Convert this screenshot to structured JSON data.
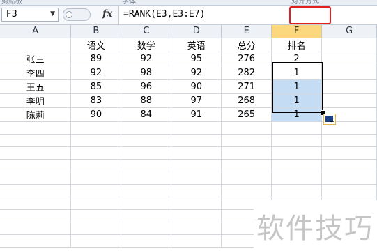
{
  "ribbon": {
    "left_label": "剪贴板",
    "mid_label": "字体",
    "right_label": "对齐方式"
  },
  "formula_bar": {
    "name_box": "F3",
    "fx_label": "fx",
    "formula": "=RANK(E3,E3:E7)"
  },
  "columns": [
    "A",
    "B",
    "C",
    "D",
    "E",
    "F",
    "G"
  ],
  "headers": [
    "",
    "语文",
    "数学",
    "英语",
    "总分",
    "排名",
    ""
  ],
  "rows": [
    {
      "name": "张三",
      "chinese": "89",
      "math": "92",
      "english": "95",
      "total": "276",
      "rank": "2"
    },
    {
      "name": "李四",
      "chinese": "92",
      "math": "98",
      "english": "92",
      "total": "282",
      "rank": "1"
    },
    {
      "name": "王五",
      "chinese": "85",
      "math": "96",
      "english": "90",
      "total": "271",
      "rank": "1"
    },
    {
      "name": "李明",
      "chinese": "83",
      "math": "88",
      "english": "97",
      "total": "268",
      "rank": "1"
    },
    {
      "name": "陈莉",
      "chinese": "90",
      "math": "84",
      "english": "91",
      "total": "265",
      "rank": "1"
    }
  ],
  "watermark": "软件技巧",
  "colors": {
    "selected_column_header": "#fbd77d",
    "selected_range": "#c4dcf4",
    "formula_highlight": "#e0201e"
  }
}
